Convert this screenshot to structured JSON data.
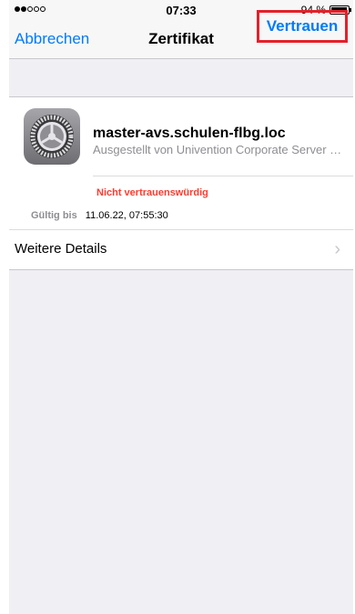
{
  "status_bar": {
    "signal_dots": [
      true,
      true,
      false,
      false,
      false
    ],
    "time": "07:33",
    "battery_percent_label": "94 %",
    "battery_level": 0.94
  },
  "nav": {
    "cancel_label": "Abbrechen",
    "title": "Zertifikat",
    "trust_label": "Vertrauen",
    "trust_highlight_color": "#e4202a",
    "accent_color": "#007aff"
  },
  "certificate": {
    "icon": "settings-gear-icon",
    "name": "master-avs.schulen-flbg.loc",
    "issuer": "Ausgestellt von Univention Corporate Server R...",
    "trust_status": "Nicht vertrauenswürdig",
    "trust_status_color": "#ff3b30",
    "valid_label": "Gültig bis",
    "valid_value": "11.06.22, 07:55:30"
  },
  "details": {
    "label": "Weitere Details",
    "chevron_icon": "chevron-right-icon"
  }
}
